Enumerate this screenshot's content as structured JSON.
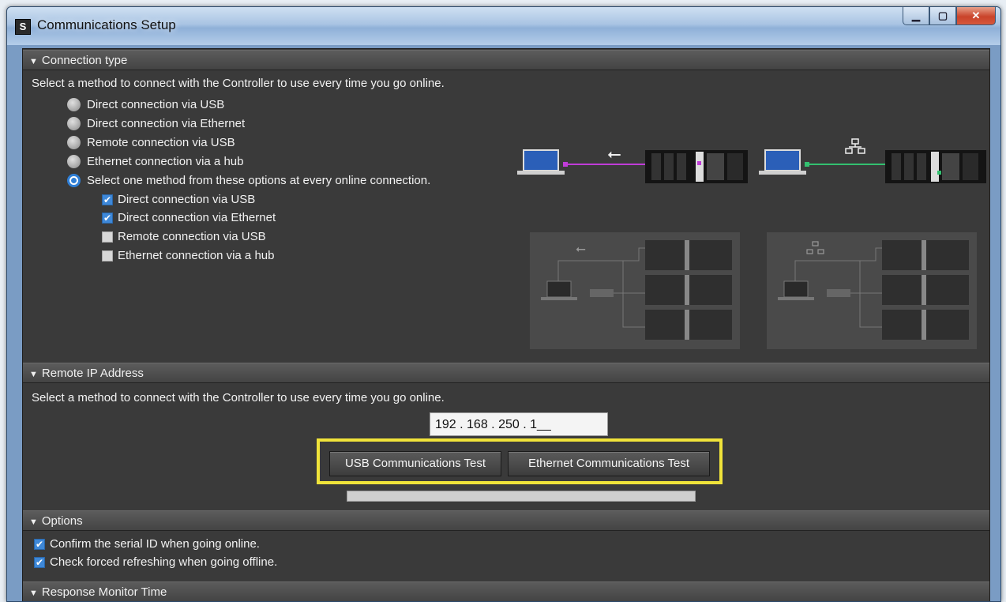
{
  "window": {
    "title": "Communications Setup"
  },
  "sections": {
    "connection_type": {
      "header": "Connection type",
      "description": "Select a method to connect with the Controller to use every time you go online.",
      "options": [
        {
          "label": "Direct connection via USB",
          "selected": false
        },
        {
          "label": "Direct connection via Ethernet",
          "selected": false
        },
        {
          "label": "Remote connection via USB",
          "selected": false
        },
        {
          "label": "Ethernet connection via a hub",
          "selected": false
        },
        {
          "label": "Select one method from these options at every online connection.",
          "selected": true
        }
      ],
      "sub_options": [
        {
          "label": "Direct connection via USB",
          "checked": true
        },
        {
          "label": "Direct connection via Ethernet",
          "checked": true
        },
        {
          "label": "Remote connection via USB",
          "checked": false
        },
        {
          "label": "Ethernet connection via a hub",
          "checked": false
        }
      ]
    },
    "remote_ip": {
      "header": "Remote IP Address",
      "description": "Select a method to connect with the Controller to use every time you go online.",
      "ip_value": "192 . 168 . 250 . 1__",
      "usb_test_label": "USB Communications Test",
      "ethernet_test_label": "Ethernet Communications Test",
      "progress": 0
    },
    "options": {
      "header": "Options",
      "items": [
        {
          "label": "Confirm the serial ID when going online.",
          "checked": true
        },
        {
          "label": "Check forced refreshing when going offline.",
          "checked": true
        }
      ]
    },
    "response_monitor": {
      "header": "Response Monitor Time"
    }
  },
  "colors": {
    "usb_line": "#c03cd8",
    "ethernet_line": "#33c070",
    "highlight": "#f0e33a",
    "selected_radio": "#2f7fd6"
  },
  "icons": [
    "app-icon",
    "minimize-icon",
    "maximize-icon",
    "close-icon",
    "usb-icon",
    "network-icon",
    "laptop-icon",
    "controller-icon",
    "hub-icon"
  ]
}
